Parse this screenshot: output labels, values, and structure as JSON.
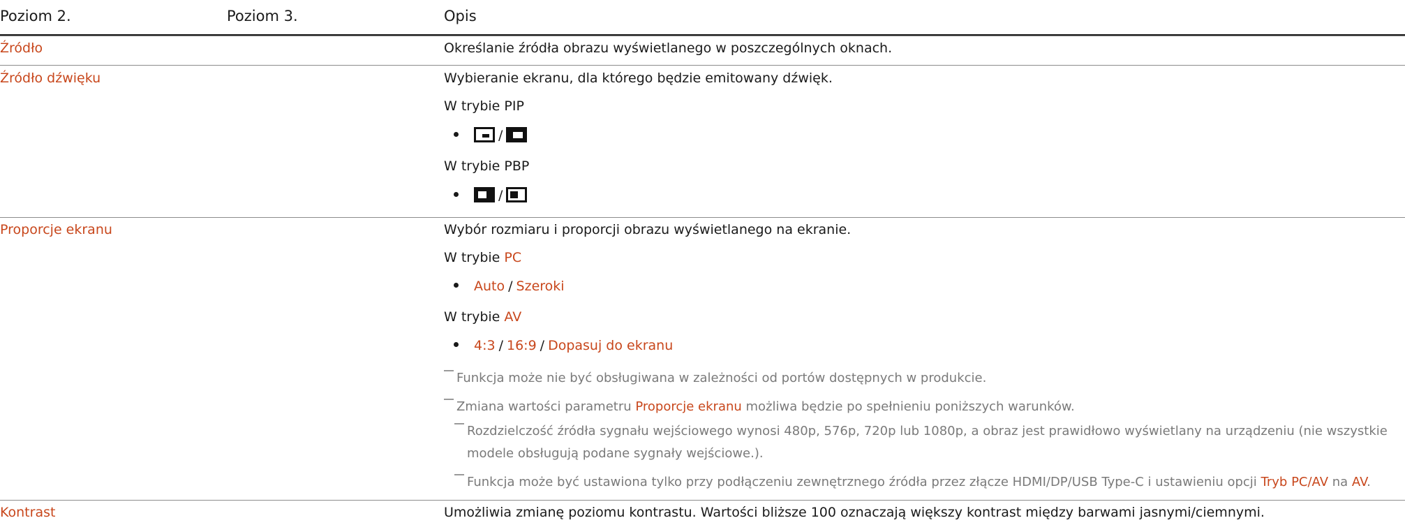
{
  "header": {
    "col1": "Poziom 2.",
    "col2": "Poziom 3.",
    "col3": "Opis"
  },
  "rows": {
    "zrodlo": {
      "label": "Źródło",
      "desc": "Określanie źródła obrazu wyświetlanego w poszczególnych oknach."
    },
    "zrodlo_dzwieku": {
      "label": "Źródło dźwięku",
      "desc": "Wybieranie ekranu, dla którego będzie emitowany dźwięk.",
      "pip": "W trybie PIP",
      "pbp": "W trybie PBP",
      "sep": "/",
      "icons": [
        "pip-large-main-icon",
        "pip-inverse-icon",
        "pbp-left-main-icon",
        "pbp-right-main-icon"
      ]
    },
    "proporcje": {
      "label": "Proporcje ekranu",
      "desc": "Wybór rozmiaru i proporcji obrazu wyświetlanego na ekranie.",
      "mode_prefix": "W trybie ",
      "pc": "PC",
      "pc_opt1": "Auto",
      "pc_opt2": "Szeroki",
      "av": "AV",
      "av_opt1": "4:3",
      "av_opt2": "16:9",
      "av_opt3": "Dopasuj do ekranu",
      "sep": "/",
      "note1": "Funkcja może nie być obsługiwana w zależności od portów dostępnych w produkcie.",
      "note2_pre": "Zmiana wartości parametru ",
      "note2_hl": "Proporcje ekranu",
      "note2_post": " możliwa będzie po spełnieniu poniższych warunków.",
      "sub1_line1": "Rozdzielczość źródła sygnału wejściowego wynosi 480p, 576p, 720p lub 1080p, a obraz jest prawidłowo wyświetlany na urządzeniu (nie wszystkie",
      "sub1_line2": "modele obsługują podane sygnały wejściowe.).",
      "sub2_pre": "Funkcja może być ustawiona tylko przy podłączeniu zewnętrznego źródła przez złącze HDMI/DP/USB Type-C i ustawieniu opcji ",
      "sub2_hl1": "Tryb PC/AV",
      "sub2_mid": " na ",
      "sub2_hl2": "AV",
      "sub2_end": "."
    },
    "kontrast": {
      "label": "Kontrast",
      "desc": "Umożliwia zmianę poziomu kontrastu. Wartości bliższe 100 oznaczają większy kontrast między barwami jasnymi/ciemnymi."
    }
  },
  "colors": {
    "accent": "#c8471c",
    "text": "#1a1a1a",
    "note": "#7a7a7a",
    "rule": "#8c8c8c"
  }
}
